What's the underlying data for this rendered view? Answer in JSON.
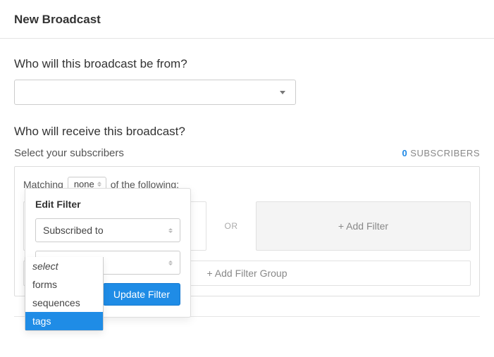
{
  "title": "New Broadcast",
  "from": {
    "heading": "Who will this broadcast be from?"
  },
  "recipients": {
    "heading": "Who will receive this broadcast?",
    "select_label": "Select your subscribers",
    "count": "0",
    "count_label": "SUBSCRIBERS"
  },
  "matching": {
    "prefix": "Matching",
    "value": "none",
    "suffix": "of the following:"
  },
  "filter_row": {
    "or": "OR",
    "add_filter": "+ Add Filter"
  },
  "add_group": "+ Add Filter Group",
  "popover": {
    "title": "Edit Filter",
    "field1": "Subscribed to",
    "field2": "select",
    "update_btn": "Update Filter"
  },
  "dropdown_options": {
    "o0": "select",
    "o1": "forms",
    "o2": "sequences",
    "o3": "tags"
  }
}
